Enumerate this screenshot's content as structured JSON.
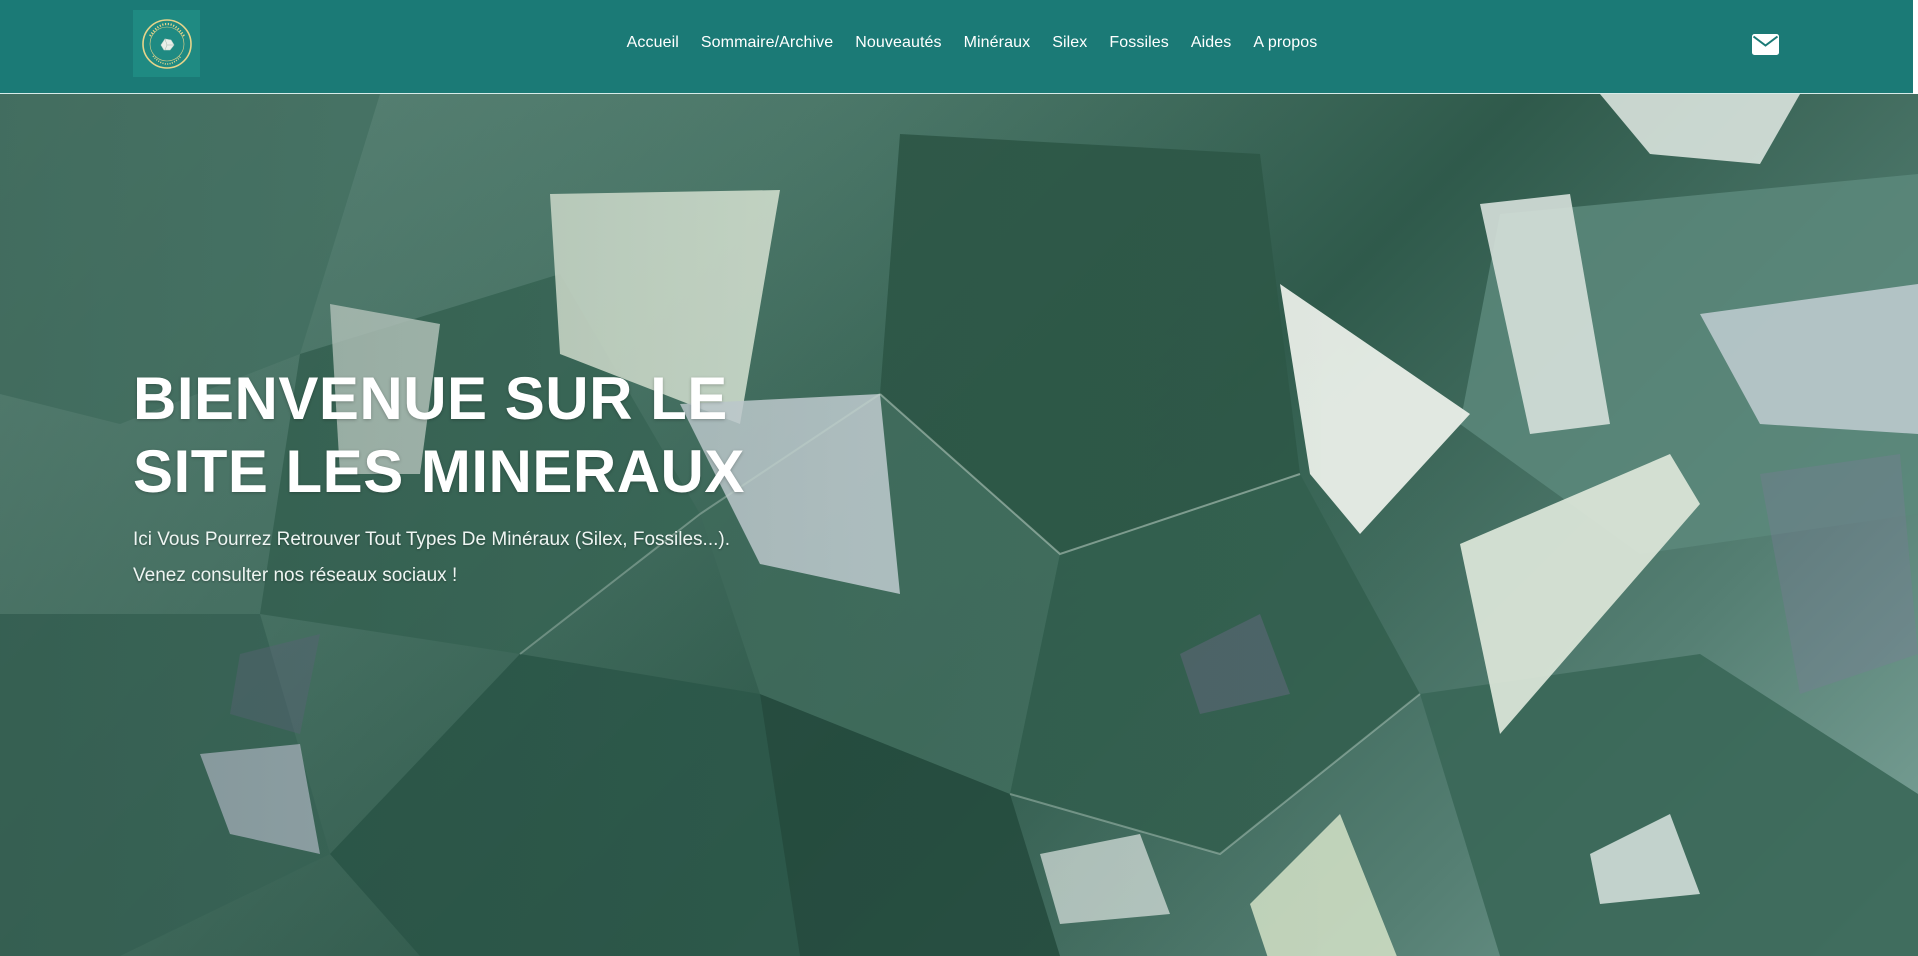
{
  "logo": {
    "top_text": "LES MINERAUX",
    "bottom_text": "Les Mineraux"
  },
  "nav": {
    "items": [
      {
        "label": "Accueil"
      },
      {
        "label": "Sommaire/Archive"
      },
      {
        "label": "Nouveautés"
      },
      {
        "label": "Minéraux"
      },
      {
        "label": "Silex"
      },
      {
        "label": "Fossiles"
      },
      {
        "label": "Aides"
      },
      {
        "label": "A propos"
      }
    ],
    "contact_icon": "envelope-icon"
  },
  "hero": {
    "title_line1": "BIENVENUE SUR LE",
    "title_line2": "SITE LES MINERAUX",
    "subtitle_line1": "Ici Vous Pourrez Retrouver Tout Types De Minéraux (Silex, Fossiles...).",
    "subtitle_line2": "Venez consulter nos réseaux sociaux !"
  },
  "colors": {
    "navbar": "#1b7a76",
    "logo_bg": "#1f8a82",
    "logo_ring": "#e6d48a",
    "text": "#ffffff"
  }
}
